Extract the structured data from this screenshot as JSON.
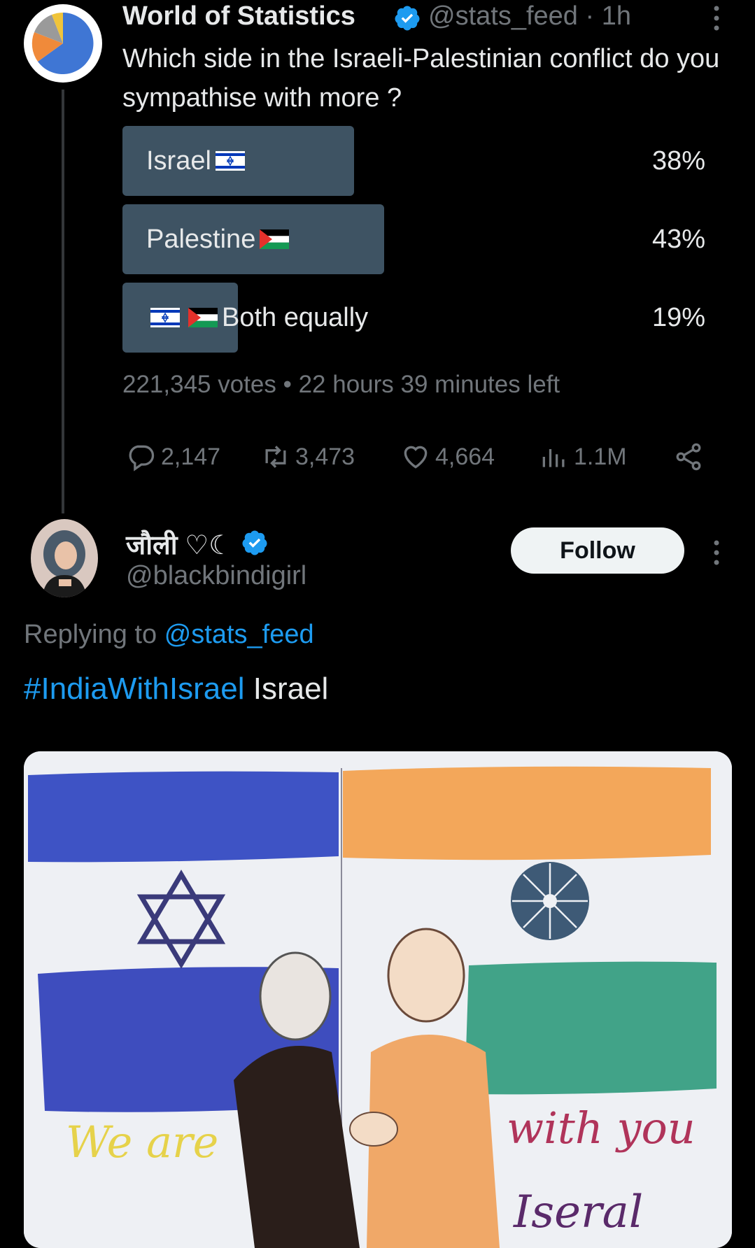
{
  "tweet1": {
    "author_name": "World of Statistics",
    "handle": "@stats_feed",
    "time": "· 1h",
    "question": "Which side in the Israeli-Palestinian conflict do you sympathise with more ?",
    "poll": {
      "options": [
        {
          "label": "Israel",
          "percent": "38%",
          "share": 0.38,
          "flags": [
            "israel"
          ]
        },
        {
          "label": "Palestine",
          "percent": "43%",
          "share": 0.43,
          "flags": [
            "palestine"
          ]
        },
        {
          "label": "Both equally",
          "percent": "19%",
          "share": 0.19,
          "flags": [
            "israel",
            "palestine"
          ]
        }
      ],
      "footer": "221,345 votes • 22 hours 39 minutes left"
    },
    "actions": {
      "replies": "2,147",
      "retweets": "3,473",
      "likes": "4,664",
      "views": "1.1M"
    }
  },
  "tweet2": {
    "author_name": "जौली ♡☾",
    "handle": "@blackbindigirl",
    "follow_label": "Follow",
    "replying_prefix": "Replying to",
    "replying_handle": "@stats_feed",
    "hashtag": "#IndiaWithIsrael",
    "text": "Israel",
    "media_text": {
      "line1": "We are",
      "line2": "with you",
      "line3": "Iseral"
    }
  },
  "colors": {
    "background": "#000000",
    "text": "#e7e9ea",
    "muted": "#71767b",
    "link": "#1d9bf0",
    "poll_bar": "#3e5363",
    "verified": "#1d9bf0"
  },
  "icons": [
    "pie-chart-avatar",
    "verified-badge-icon",
    "more-icon",
    "reply-icon",
    "retweet-icon",
    "like-icon",
    "views-icon",
    "share-icon"
  ]
}
